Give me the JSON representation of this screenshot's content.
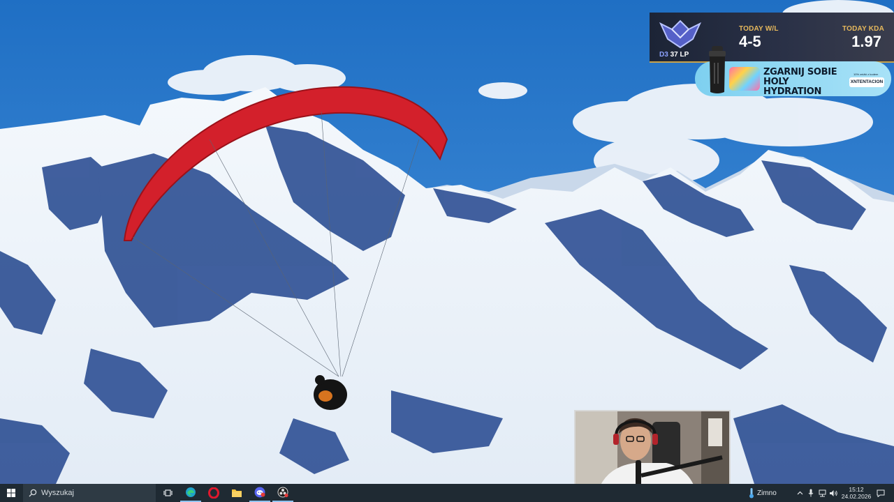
{
  "overlay": {
    "rank": {
      "tier": "D3",
      "lp": "37 LP",
      "icon": "diamond-rank-emblem"
    },
    "stats": {
      "wl_label": "TODAY W/L",
      "wl_value": "4-5",
      "kda_label": "TODAY KDA",
      "kda_value": "1.97"
    },
    "colors": {
      "label_gold": "#e6b85c",
      "value_white": "#ffffff",
      "tier_blue": "#8da2ff"
    }
  },
  "sponsor": {
    "headline": "ZGARNIJ SOBIE HOLY HYDRATION",
    "small_text": "10% zniżki z kodem",
    "code": "XNTENTACION",
    "icon": "shaker-bottle-icon",
    "background": "#a8e2f7"
  },
  "wallpaper": {
    "subject": "paraglider-over-snowy-mountains"
  },
  "webcam": {
    "icon": "streamer-webcam"
  },
  "taskbar": {
    "start_icon": "windows-logo-icon",
    "search_placeholder": "Wyszukaj",
    "apps": [
      {
        "name": "Edge",
        "icon": "edge-icon",
        "active": true
      },
      {
        "name": "Opera",
        "icon": "opera-icon",
        "active": false
      },
      {
        "name": "File Explorer",
        "icon": "folder-icon",
        "active": false
      },
      {
        "name": "Discord",
        "icon": "discord-icon",
        "active": true
      },
      {
        "name": "OBS",
        "icon": "obs-icon",
        "active": true
      }
    ],
    "weather": {
      "label": "Zimno",
      "icon": "thermometer-icon"
    },
    "tray": {
      "chevron": "chevron-up-icon",
      "mic": "microphone-icon",
      "network": "network-icon",
      "volume": "volume-icon"
    },
    "clock": {
      "time": "15:12",
      "date": "24.02.2026"
    }
  }
}
